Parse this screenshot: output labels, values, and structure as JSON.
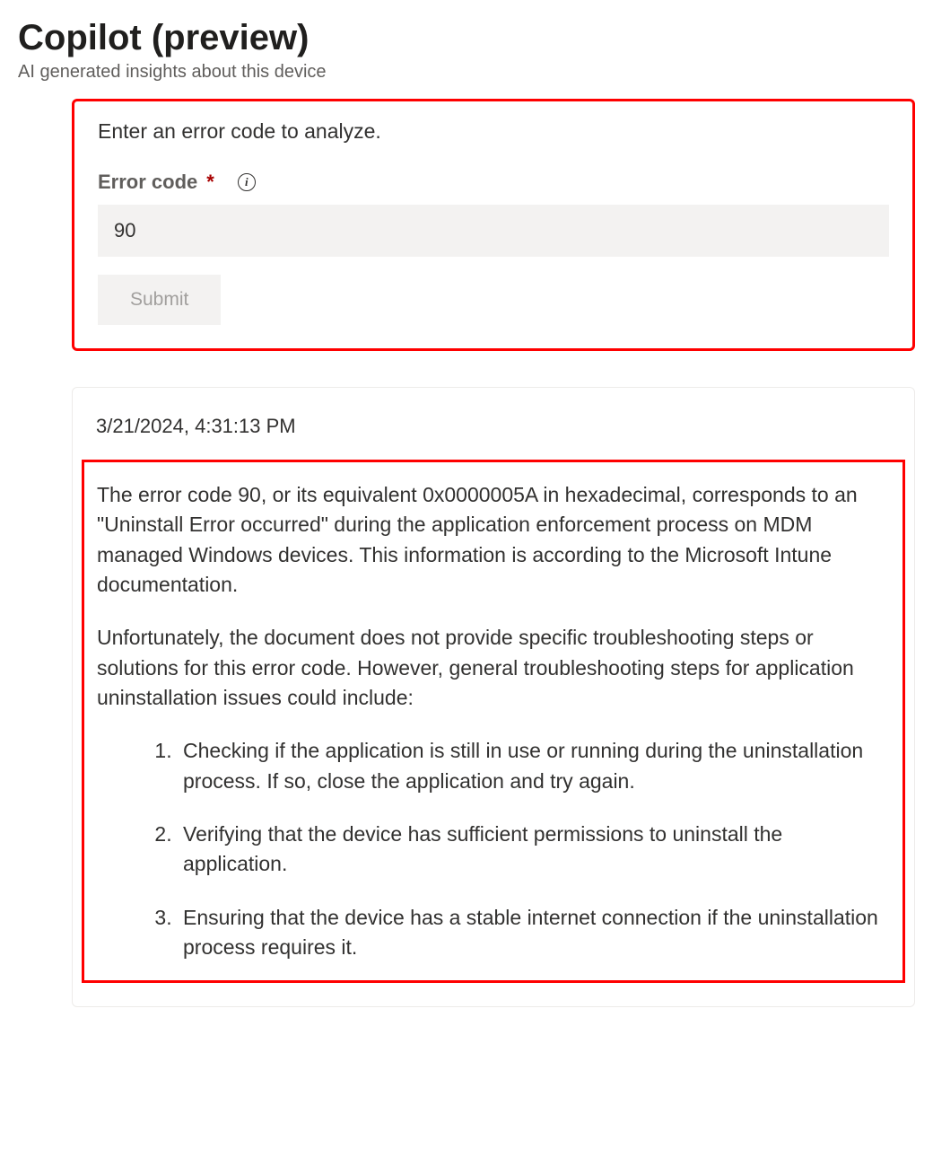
{
  "header": {
    "title": "Copilot (preview)",
    "subtitle": "AI generated insights about this device"
  },
  "form": {
    "prompt": "Enter an error code to analyze.",
    "field_label": "Error code",
    "required_marker": "*",
    "info_icon_label": "i",
    "value": "90",
    "submit_label": "Submit"
  },
  "response": {
    "timestamp": "3/21/2024, 4:31:13 PM",
    "paragraph1": "The error code 90, or its equivalent 0x0000005A in hexadecimal, corresponds to an \"Uninstall Error occurred\" during the application enforcement process on MDM managed Windows devices. This information is according to the Microsoft Intune documentation.",
    "paragraph2": "Unfortunately, the document does not provide specific troubleshooting steps or solutions for this error code. However, general troubleshooting steps for application uninstallation issues could include:",
    "steps": [
      "Checking if the application is still in use or running during the uninstallation process. If so, close the application and try again.",
      "Verifying that the device has sufficient permissions to uninstall the application.",
      "Ensuring that the device has a stable internet connection if the uninstallation process requires it."
    ]
  }
}
